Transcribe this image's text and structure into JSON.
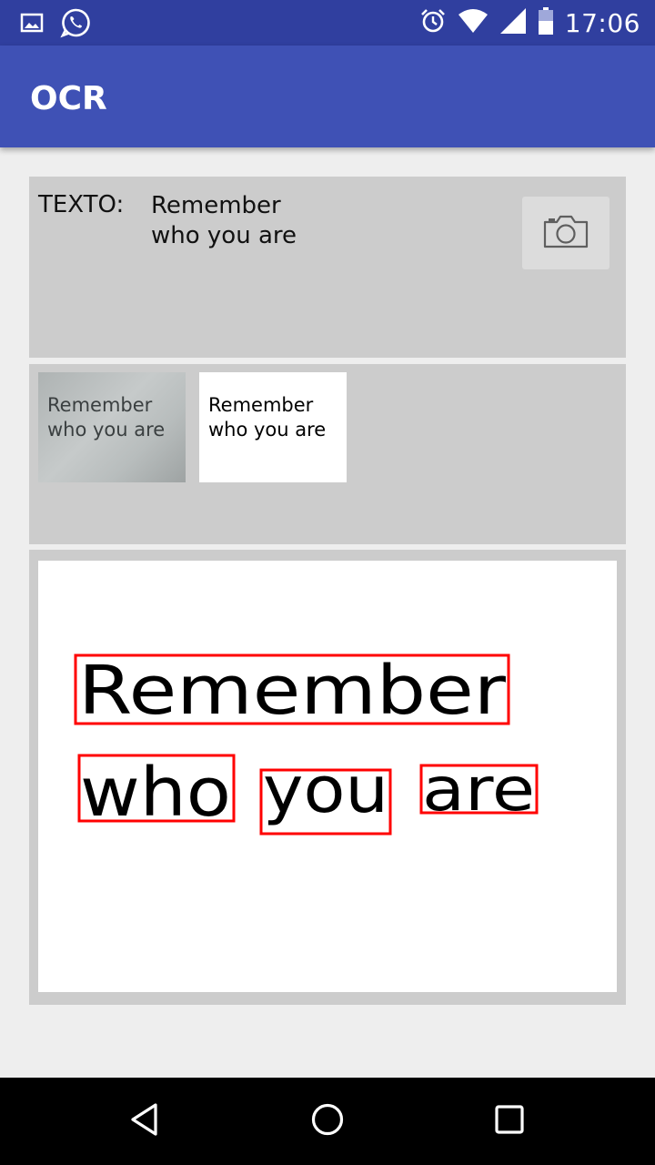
{
  "status_bar": {
    "time": "17:06",
    "left_icons": [
      "gallery-icon",
      "whatsapp-icon"
    ],
    "right_icons": [
      "alarm-icon",
      "wifi-icon",
      "signal-icon",
      "battery-icon"
    ]
  },
  "app_bar": {
    "title": "OCR",
    "color": "#3f51b5",
    "status_color": "#303f9f"
  },
  "text_panel": {
    "label": "TEXTO:",
    "result_lines": [
      "Remember",
      "who you are"
    ],
    "camera_button_icon": "camera-icon"
  },
  "thumbnails": {
    "original": {
      "lines": [
        "Remember",
        "who you are"
      ]
    },
    "processed": {
      "lines": [
        "Remember",
        "who you are"
      ]
    }
  },
  "result_image": {
    "words": [
      "Remember",
      "who",
      "you",
      "are"
    ],
    "box_color": "#ff0000"
  },
  "nav_bar": {
    "icons": [
      "back-icon",
      "home-icon",
      "recents-icon"
    ]
  }
}
